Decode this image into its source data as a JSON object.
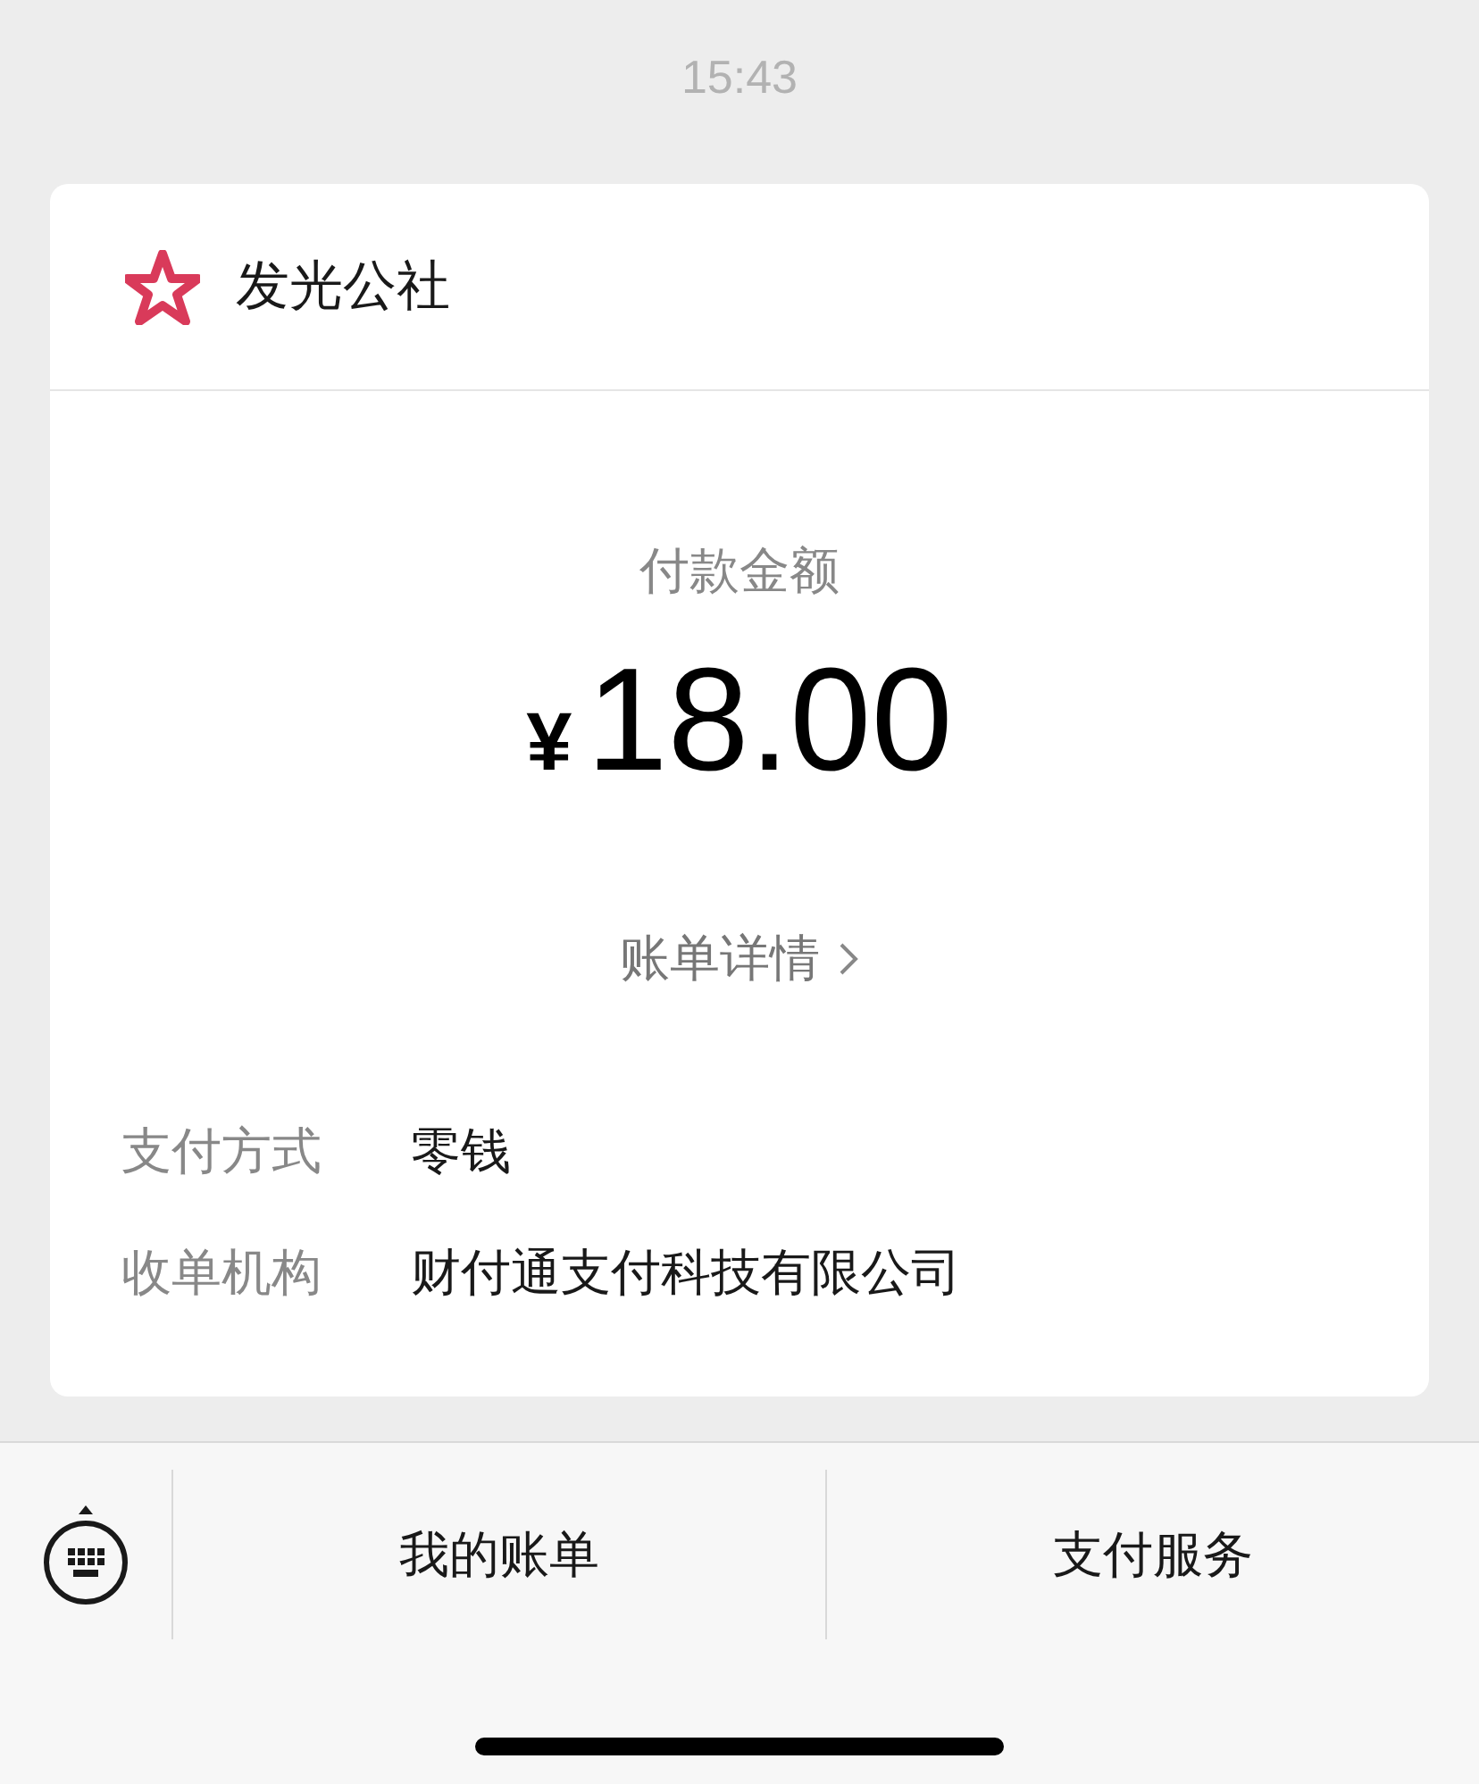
{
  "time": "15:43",
  "merchant": {
    "name": "发光公社"
  },
  "payment": {
    "label": "付款金额",
    "currency": "¥",
    "amount": "18.00",
    "details_link": "账单详情"
  },
  "info": [
    {
      "label": "支付方式",
      "value": "零钱"
    },
    {
      "label": "收单机构",
      "value": "财付通支付科技有限公司"
    }
  ],
  "bottom_menu": [
    "我的账单",
    "支付服务"
  ]
}
